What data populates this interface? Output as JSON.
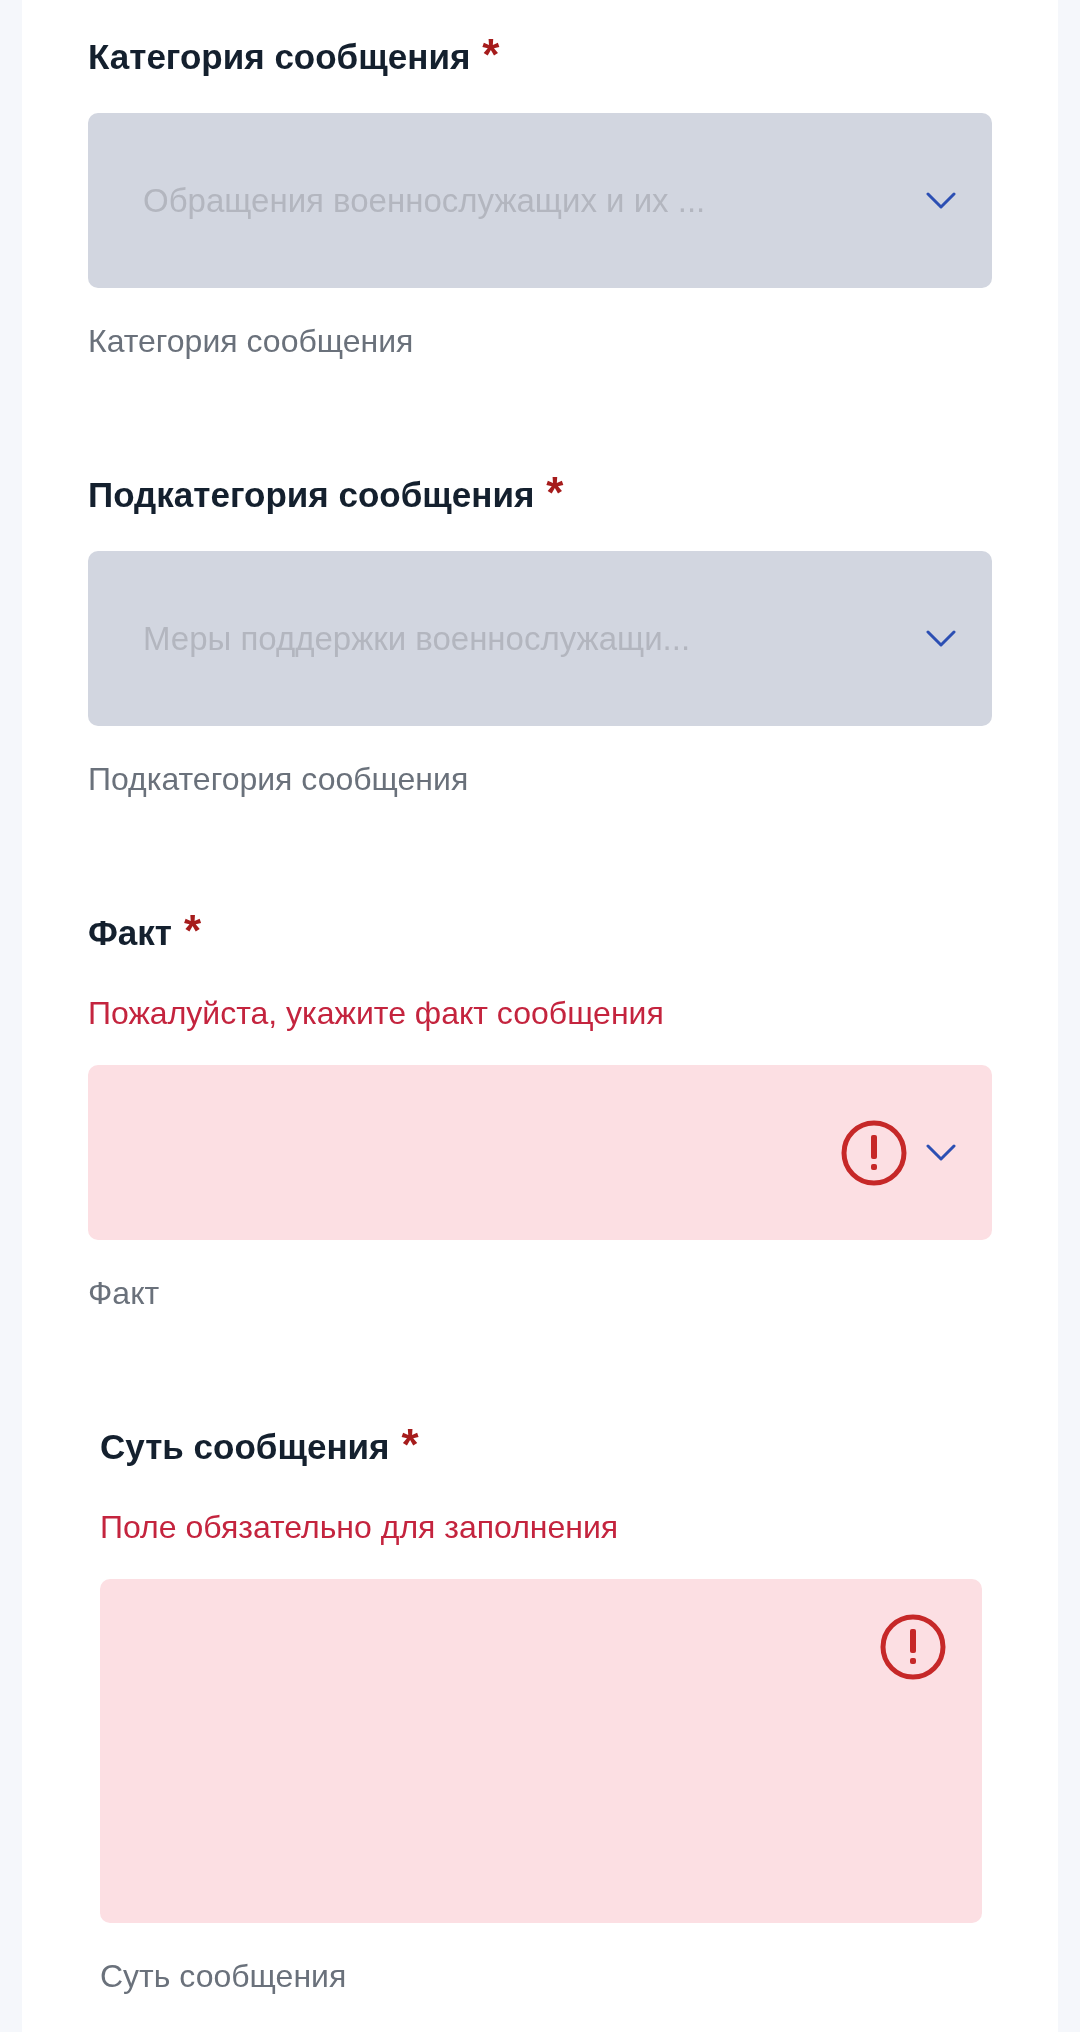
{
  "fields": [
    {
      "kind": "select",
      "label": "Категория сообщения",
      "required_mark": "*",
      "value": "Обращения военнослужащих и их ...",
      "disabled": true,
      "error": false,
      "helper": "Категория сообщения"
    },
    {
      "kind": "select",
      "label": "Подкатегория сообщения",
      "required_mark": "*",
      "value": "Меры поддержки военнослужащи...",
      "disabled": true,
      "error": false,
      "helper": "Подкатегория сообщения"
    },
    {
      "kind": "select",
      "label": "Факт",
      "required_mark": "*",
      "error_message": "Пожалуйста, укажите факт сообщения",
      "disabled": false,
      "error": true,
      "helper": "Факт"
    },
    {
      "kind": "textarea",
      "label": "Суть сообщения",
      "required_mark": "*",
      "error_message": "Поле обязательно для заполнения",
      "disabled": false,
      "error": true,
      "helper": "Суть сообщения"
    }
  ]
}
